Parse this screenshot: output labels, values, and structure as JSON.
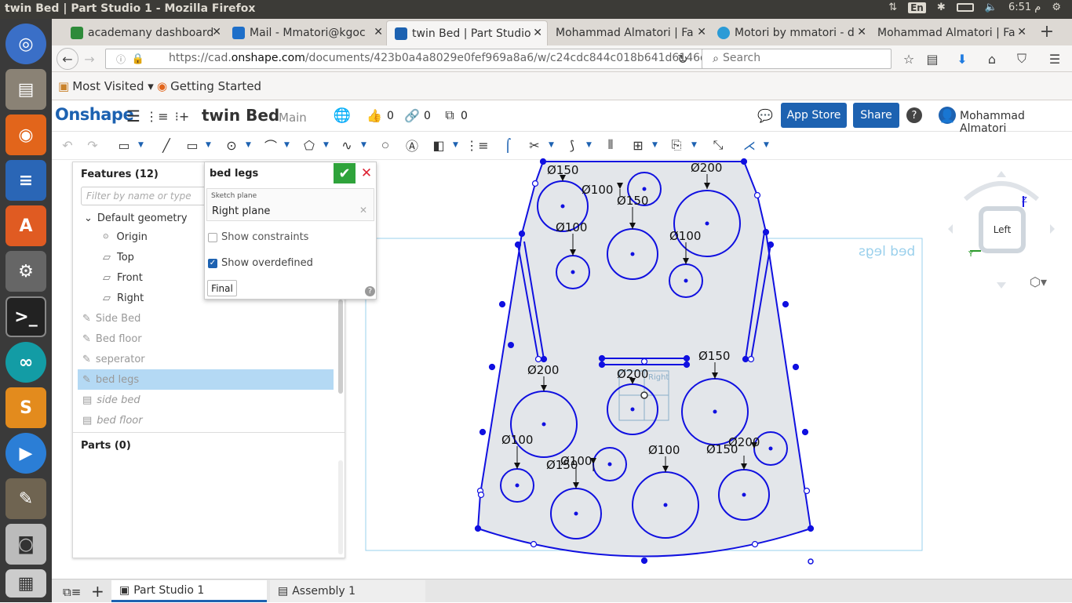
{
  "window": {
    "title": "twin Bed | Part Studio 1 - Mozilla Firefox"
  },
  "tray": {
    "keyboard": "En",
    "time": "6:51 م"
  },
  "browser": {
    "tabs": [
      {
        "label": "academany dashboard",
        "fav_color": "#2e8b3a"
      },
      {
        "label": "Mail - Mmatori@kgoc",
        "fav_color": "#1e6fc9"
      },
      {
        "label": "twin Bed | Part Studio",
        "fav_color": "#1d62b1"
      },
      {
        "label": "Mohammad Almatori | Fa",
        "fav_color": ""
      },
      {
        "label": "Motori by mmatori - d",
        "fav_color": "#2b9bd6"
      },
      {
        "label": "Mohammad Almatori | Fa",
        "fav_color": ""
      }
    ],
    "url_prefix": "https://cad.",
    "url_host": "onshape.com",
    "url_rest": "/documents/423b0a4a8029e0fef969a8a6/w/c24cdc844c018b641d6146d6/e",
    "search_placeholder": "Search",
    "bookmarks": [
      {
        "label": "Most Visited ▾"
      },
      {
        "label": "Getting Started"
      }
    ]
  },
  "onshape": {
    "logo": "Onshape",
    "doc_name": "twin Bed",
    "branch": "Main",
    "likes": "0",
    "links": "0",
    "copies": "0",
    "app_store": "App Store",
    "share": "Share",
    "help": "?",
    "user": "Mohammad Almatori"
  },
  "features": {
    "header": "Features (12)",
    "filter_placeholder": "Filter by name or type",
    "default_geometry": "Default geometry",
    "items": [
      "Origin",
      "Top",
      "Front",
      "Right",
      "Side Bed",
      "Bed floor",
      "seperator",
      "bed legs",
      "side bed",
      "bed floor"
    ],
    "parts": "Parts (0)"
  },
  "sketch_dialog": {
    "name": "bed legs",
    "plane_label": "Sketch plane",
    "plane_value": "Right plane",
    "show_constraints": "Show constraints",
    "show_overdefined": "Show overdefined",
    "final": "Final",
    "show_constraints_checked": false,
    "show_overdefined_checked": true
  },
  "viewport": {
    "plane_label": "bed legs",
    "small_plane_label": "Right",
    "view_label": "Left",
    "axis_z": "Z",
    "axis_y": "Y",
    "dimensions": [
      "Ø150",
      "Ø100",
      "Ø200",
      "Ø150",
      "Ø100",
      "Ø100",
      "Ø200",
      "Ø200",
      "Ø150",
      "Ø100",
      "Ø150",
      "Ø100",
      "Ø200",
      "Ø100",
      "Ø150"
    ]
  },
  "bottom_tabs": [
    {
      "label": "Part Studio 1"
    },
    {
      "label": "Assembly 1"
    }
  ],
  "colors": {
    "sketch": "#1010e0",
    "brand": "#1d62b1",
    "selected": "#b4d9f4"
  }
}
